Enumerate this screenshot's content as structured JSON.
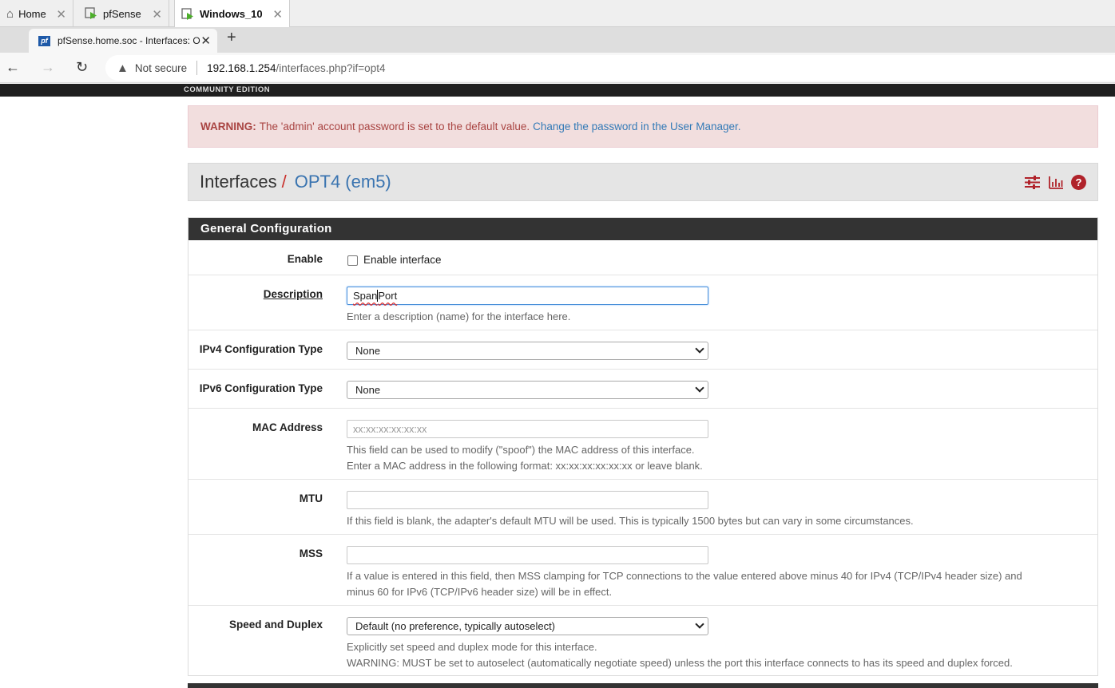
{
  "vm_tabs": [
    {
      "label": "Home"
    },
    {
      "label": "pfSense"
    },
    {
      "label": "Windows_10"
    }
  ],
  "browser": {
    "tab_title": "pfSense.home.soc - Interfaces: O",
    "security_label": "Not secure",
    "url_host": "192.168.1.254",
    "url_path": "/interfaces.php?if=opt4"
  },
  "header": {
    "edition": "COMMUNITY EDITION"
  },
  "alert": {
    "label": "WARNING:",
    "text": "The 'admin' account password is set to the default value.",
    "link": "Change the password in the User Manager."
  },
  "breadcrumb": {
    "section": "Interfaces",
    "separator": "/",
    "current": "OPT4 (em5)"
  },
  "panel": {
    "title": "General Configuration",
    "enable": {
      "label": "Enable",
      "checkbox_label": "Enable interface",
      "checked": false
    },
    "description": {
      "label": "Description",
      "value_part1": "Span",
      "value_part2": "Port",
      "help": "Enter a description (name) for the interface here."
    },
    "ipv4": {
      "label": "IPv4 Configuration Type",
      "selected": "None"
    },
    "ipv6": {
      "label": "IPv6 Configuration Type",
      "selected": "None"
    },
    "mac": {
      "label": "MAC Address",
      "placeholder": "xx:xx:xx:xx:xx:xx",
      "help1": "This field can be used to modify (\"spoof\") the MAC address of this interface.",
      "help2": "Enter a MAC address in the following format: xx:xx:xx:xx:xx:xx or leave blank."
    },
    "mtu": {
      "label": "MTU",
      "value": "",
      "help": "If this field is blank, the adapter's default MTU will be used. This is typically 1500 bytes but can vary in some circumstances."
    },
    "mss": {
      "label": "MSS",
      "value": "",
      "help1": "If a value is entered in this field, then MSS clamping for TCP connections to the value entered above minus 40 for IPv4 (TCP/IPv4 header size) and",
      "help2": "minus 60 for IPv6 (TCP/IPv6 header size) will be in effect."
    },
    "speed": {
      "label": "Speed and Duplex",
      "selected": "Default (no preference, typically autoselect)",
      "help1": "Explicitly set speed and duplex mode for this interface.",
      "help2": "WARNING: MUST be set to autoselect (automatically negotiate speed) unless the port this interface connects to has its speed and duplex forced."
    }
  },
  "colors": {
    "accent_red": "#b0222a",
    "link_blue": "#337ab7",
    "panel_dark": "#333333",
    "alert_bg": "#f2dede"
  }
}
